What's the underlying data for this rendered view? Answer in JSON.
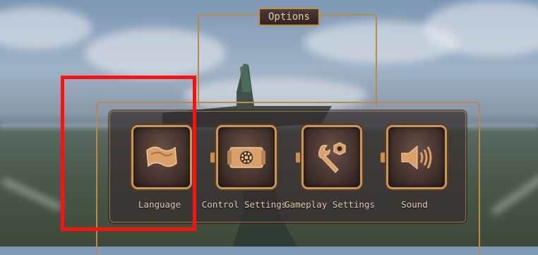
{
  "window": {
    "title": "Options"
  },
  "options": [
    {
      "label": "Language",
      "icon": "flag-icon"
    },
    {
      "label": "Control Settings",
      "icon": "gear-card-icon"
    },
    {
      "label": "Gameplay Settings",
      "icon": "wrench-nut-icon"
    },
    {
      "label": "Sound",
      "icon": "speaker-icon"
    }
  ],
  "colors": {
    "frame": "#b88a4e",
    "label": "#e7cda9",
    "highlight": "#ff1010"
  }
}
